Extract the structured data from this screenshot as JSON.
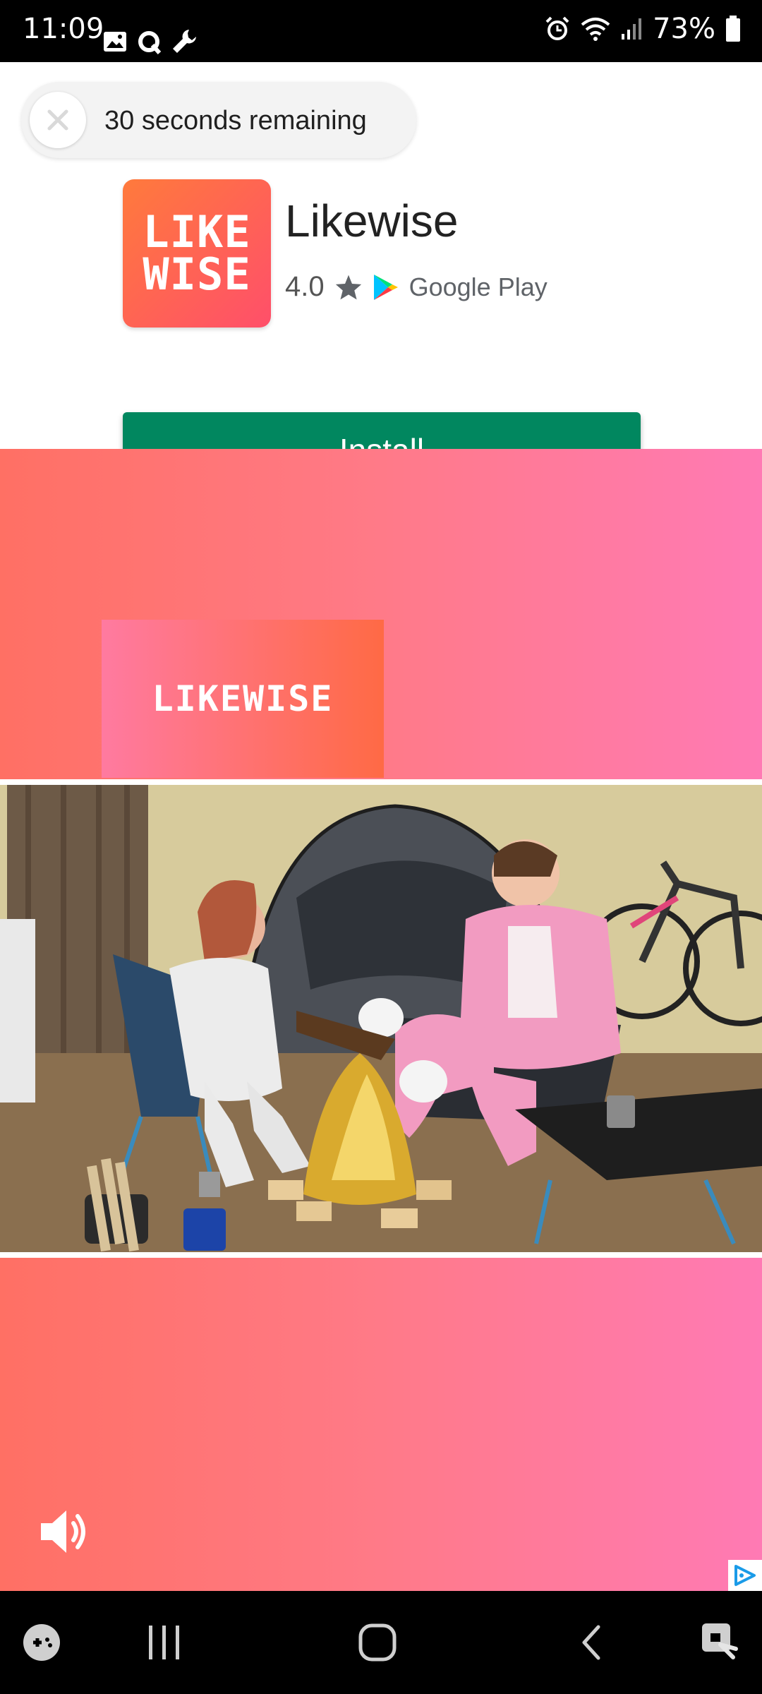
{
  "status_bar": {
    "time": "11:09",
    "battery": "73%",
    "icons": [
      "gallery-icon",
      "q-icon",
      "wrench-icon",
      "alarm-icon",
      "wifi-icon",
      "signal-icon",
      "battery-icon"
    ]
  },
  "ad": {
    "timer_text": "30 seconds remaining",
    "app_icon_lines": [
      "LIKE",
      "WISE"
    ],
    "app_name": "Likewise",
    "rating": "4.0",
    "store_label": "Google Play",
    "install_label": "Install",
    "colors": {
      "install": "#01875f",
      "gradient_left": "#ff7064",
      "gradient_right": "#ff7ab4"
    }
  },
  "video": {
    "brand_card_text": "LIKEWISE"
  },
  "nav_bar": {
    "items": [
      "game-tools-icon",
      "recent-apps-icon",
      "home-icon",
      "back-icon",
      "screen-lock-icon"
    ]
  }
}
